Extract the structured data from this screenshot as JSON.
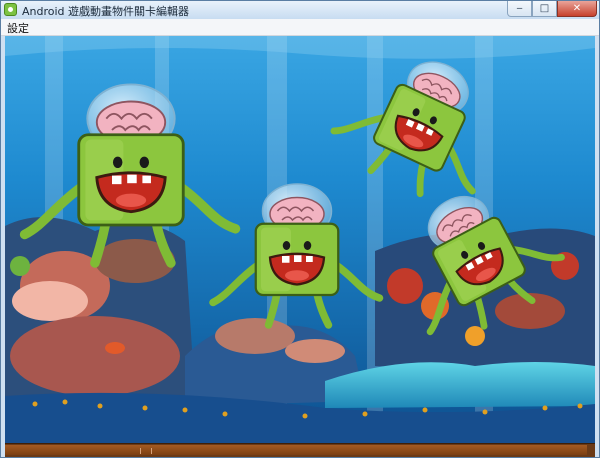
{
  "window": {
    "title": "Android 遊戲動畫物件關卡編輯器",
    "minimize_glyph": "‒",
    "maximize_glyph": "□",
    "close_glyph": "✕"
  },
  "menu": {
    "items": [
      {
        "label": "設定"
      }
    ]
  },
  "scene": {
    "background": "underwater-coral-reef",
    "monsters": [
      {
        "name": "brain-monster",
        "color": "#8cc63e"
      },
      {
        "name": "brain-monster",
        "color": "#8cc63e"
      },
      {
        "name": "brain-monster",
        "color": "#8cc63e"
      },
      {
        "name": "brain-monster",
        "color": "#8cc63e"
      }
    ]
  },
  "scrollbar": {
    "type": "horizontal",
    "color": "#7b3f12"
  },
  "colors": {
    "water": "#1e8ad0",
    "monster": "#8cc63e",
    "mouth": "#c42a1e"
  }
}
